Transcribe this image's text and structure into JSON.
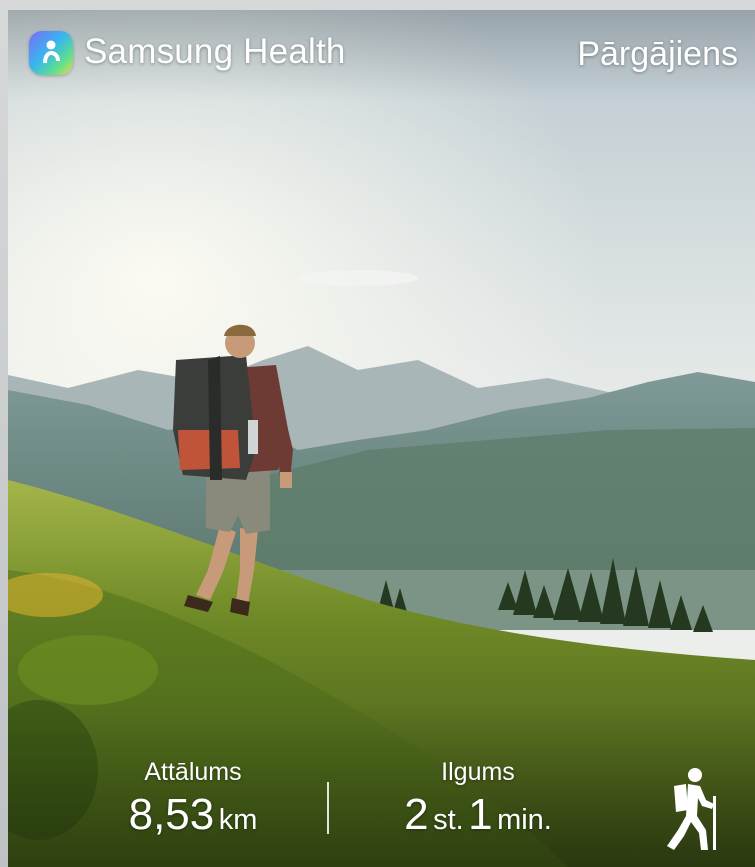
{
  "app": {
    "name": "Samsung Health",
    "icon": "samsung-health-app-icon"
  },
  "activity": {
    "type": "Pārgājiens",
    "icon": "hiking-icon"
  },
  "stats": {
    "distance": {
      "label": "Attālums",
      "value": "8,53",
      "unit": "km"
    },
    "duration": {
      "label": "Ilgums",
      "hours": "2",
      "hours_unit": "st.",
      "minutes": "1",
      "minutes_unit": "min."
    }
  },
  "colors": {
    "text": "#ffffff",
    "sky": "#dfe6ea",
    "grass": "#7e9a2c"
  }
}
